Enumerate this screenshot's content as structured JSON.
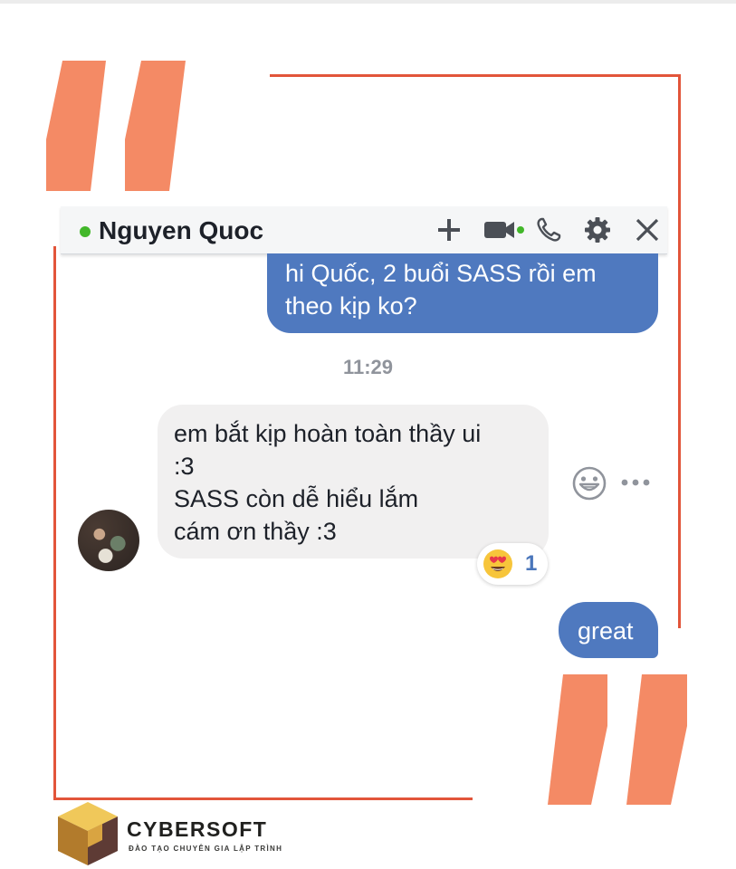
{
  "chat": {
    "contact_name": "Nguyen Quoc",
    "status": "online",
    "header_icons": [
      "plus-icon",
      "video-camera-icon",
      "phone-icon",
      "gear-icon",
      "close-icon"
    ]
  },
  "messages": {
    "outgoing_1_lines": [
      "hi Quốc, 2 buổi SASS rồi em",
      "theo kịp ko?"
    ],
    "timestamp": "11:29",
    "incoming_lines": [
      "em bắt kịp hoàn toàn thầy ui",
      ":3",
      "SASS còn dễ hiểu lắm",
      "cám ơn thầy :3"
    ],
    "reaction": {
      "emoji": "heart-eyes-emoji",
      "count": "1"
    },
    "outgoing_2": "great"
  },
  "colors": {
    "frame": "#e2553a",
    "quote": "#f48a65",
    "outgoing_bubble": "#4f79bf",
    "incoming_bubble": "#f1f0f0",
    "online": "#42b72a",
    "reaction_count": "#4a76bb"
  },
  "logo": {
    "title": "CYBERSOFT",
    "tagline": "ĐÀO TẠO CHUYÊN GIA LẬP TRÌNH"
  }
}
